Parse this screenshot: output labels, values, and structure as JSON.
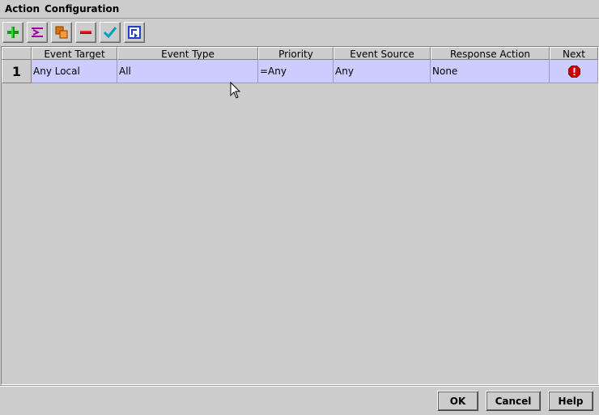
{
  "menu": {
    "items": [
      "Action",
      "Configuration"
    ]
  },
  "toolbar": {
    "buttons": [
      {
        "name": "add",
        "icon": "plus-icon",
        "color": "#00a000"
      },
      {
        "name": "insert",
        "icon": "insert-icon",
        "color": "#a000a0"
      },
      {
        "name": "copy",
        "icon": "copy-icon",
        "color": "#e07000"
      },
      {
        "name": "delete",
        "icon": "minus-icon",
        "color": "#c00000"
      },
      {
        "name": "apply",
        "icon": "checkmark-icon",
        "color": "#00a0c0"
      },
      {
        "name": "refresh",
        "icon": "refresh-icon",
        "color": "#2040c0"
      }
    ]
  },
  "table": {
    "columns": [
      "Event Target",
      "Event Type",
      "Priority",
      "Event Source",
      "Response Action",
      "Next"
    ],
    "rows": [
      {
        "num": "1",
        "event_target": "Any Local",
        "event_type": "All",
        "priority": "=Any",
        "event_source": "Any",
        "response_action": "None",
        "next_icon": "stop-error-icon"
      }
    ],
    "selected_row_color": "#ccccff"
  },
  "footer": {
    "ok": "OK",
    "cancel": "Cancel",
    "help": "Help"
  }
}
